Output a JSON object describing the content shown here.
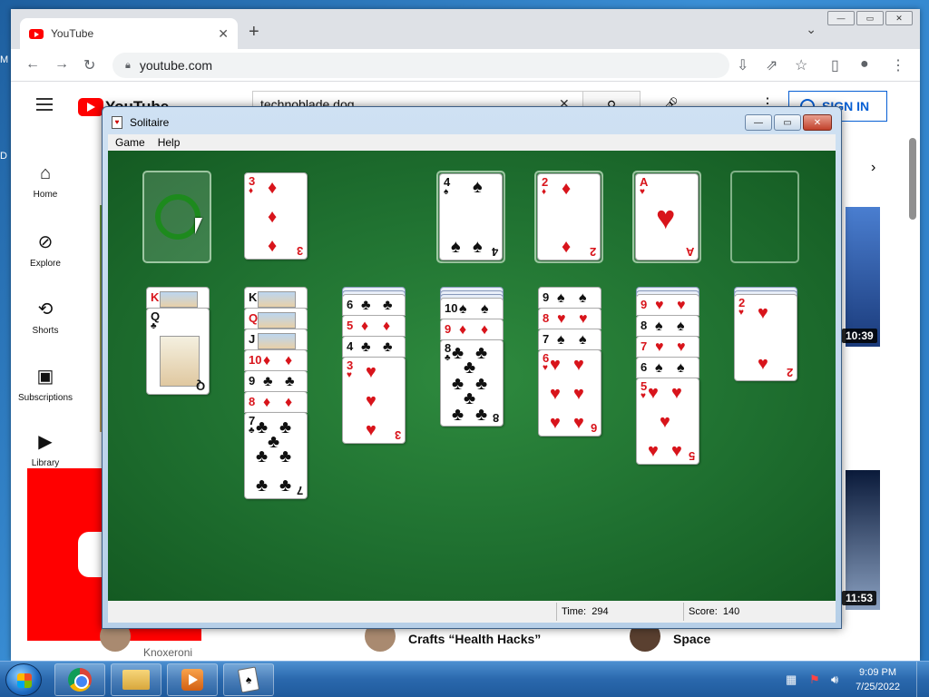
{
  "browser": {
    "tab_title": "YouTube",
    "tab_close": "✕",
    "new_tab": "+",
    "url": "youtube.com"
  },
  "youtube": {
    "brand": "YouTube",
    "search_value": "technoblade dog",
    "sign_in": "SIGN IN",
    "nav": [
      "Home",
      "Explore",
      "Shorts",
      "Subscriptions",
      "Library"
    ],
    "durations": [
      "10:39",
      "11:53"
    ],
    "channel_1": "Knoxeroni",
    "video_title_2": "Crafts “Health Hacks”",
    "video_title_3": "Space"
  },
  "solitaire": {
    "title": "Solitaire",
    "menu": [
      "Game",
      "Help"
    ],
    "time_label": "Time:",
    "time_value": "294",
    "score_label": "Score:",
    "score_value": "140",
    "waste": {
      "rank": "3",
      "suit": "♦",
      "color": "red"
    },
    "foundations": [
      {
        "rank": "4",
        "suit": "♠",
        "color": "blk"
      },
      {
        "rank": "2",
        "suit": "♦",
        "color": "red"
      },
      {
        "rank": "A",
        "suit": "♥",
        "color": "red"
      }
    ],
    "tableau": [
      {
        "hidden": 0,
        "face_rows": [
          {
            "rank": "K",
            "suit": "♣",
            "color": "red",
            "face": true
          }
        ],
        "top": {
          "rank": "Q",
          "suit": "♣",
          "color": "blk",
          "face": true
        }
      },
      {
        "hidden": 0,
        "face_rows": [
          {
            "rank": "K",
            "suit": "♠",
            "color": "blk",
            "face": true
          },
          {
            "rank": "Q",
            "suit": "♥",
            "color": "red",
            "face": true
          },
          {
            "rank": "J",
            "suit": "♠",
            "color": "blk",
            "face": true
          },
          {
            "rank": "10",
            "suit": "♦",
            "color": "red"
          },
          {
            "rank": "9",
            "suit": "♣",
            "color": "blk"
          },
          {
            "rank": "8",
            "suit": "♦",
            "color": "red"
          }
        ],
        "top": {
          "rank": "7",
          "suit": "♣",
          "color": "blk"
        }
      },
      {
        "hidden": 2,
        "face_rows": [
          {
            "rank": "6",
            "suit": "♣",
            "color": "blk"
          },
          {
            "rank": "5",
            "suit": "♦",
            "color": "red"
          },
          {
            "rank": "4",
            "suit": "♣",
            "color": "blk"
          }
        ],
        "top": {
          "rank": "3",
          "suit": "♥",
          "color": "red"
        }
      },
      {
        "hidden": 3,
        "face_rows": [
          {
            "rank": "10",
            "suit": "♠",
            "color": "blk"
          },
          {
            "rank": "9",
            "suit": "♦",
            "color": "red"
          }
        ],
        "top": {
          "rank": "8",
          "suit": "♣",
          "color": "blk"
        }
      },
      {
        "hidden": 0,
        "face_rows": [
          {
            "rank": "9",
            "suit": "♠",
            "color": "blk"
          },
          {
            "rank": "8",
            "suit": "♥",
            "color": "red"
          },
          {
            "rank": "7",
            "suit": "♠",
            "color": "blk"
          }
        ],
        "top": {
          "rank": "6",
          "suit": "♥",
          "color": "red"
        }
      },
      {
        "hidden": 2,
        "face_rows": [
          {
            "rank": "9",
            "suit": "♥",
            "color": "red"
          },
          {
            "rank": "8",
            "suit": "♠",
            "color": "blk"
          },
          {
            "rank": "7",
            "suit": "♥",
            "color": "red"
          },
          {
            "rank": "6",
            "suit": "♠",
            "color": "blk"
          }
        ],
        "top": {
          "rank": "5",
          "suit": "♥",
          "color": "red"
        }
      },
      {
        "hidden": 2,
        "face_rows": [],
        "top": {
          "rank": "2",
          "suit": "♥",
          "color": "red"
        }
      }
    ]
  },
  "taskbar": {
    "time": "9:09 PM",
    "date": "7/25/2022"
  }
}
